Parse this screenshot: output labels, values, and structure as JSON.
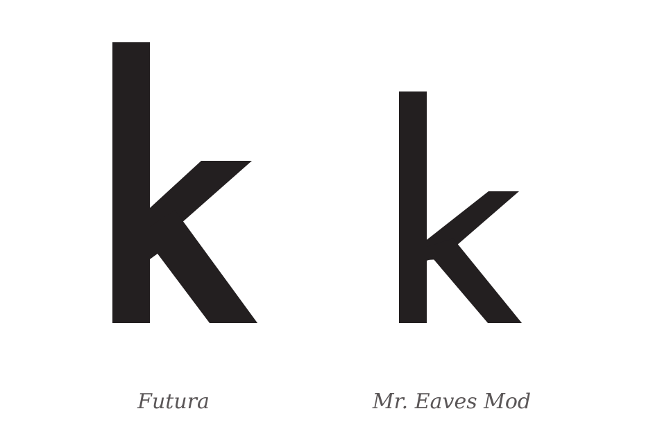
{
  "glyphs": [
    {
      "character": "k",
      "typeface": "Futura",
      "icon": "futura-k-glyph",
      "color": "#231f20"
    },
    {
      "character": "k",
      "typeface": "Mr. Eaves Mod",
      "icon": "mr-eaves-mod-k-glyph",
      "color": "#231f20"
    }
  ],
  "colors": {
    "background": "#ffffff",
    "glyph": "#231f20",
    "caption": "#5a5657"
  }
}
